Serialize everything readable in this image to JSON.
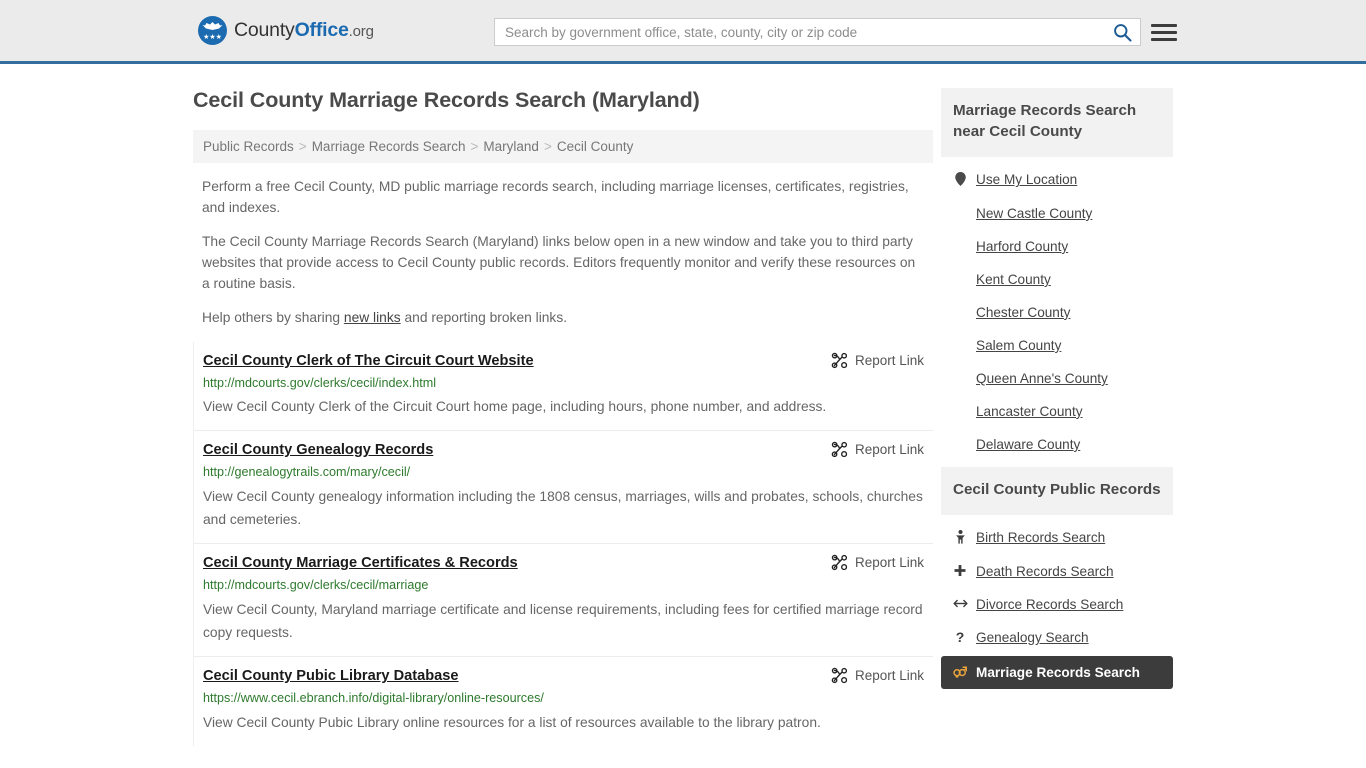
{
  "header": {
    "brand": {
      "part1": "County",
      "part2": "Office",
      "part3": ".org",
      "logo_icon": "eagle-shield-logo",
      "stars": "★★★"
    },
    "search": {
      "placeholder": "Search by government office, state, county, city or zip code",
      "value": "",
      "icon": "search-icon"
    },
    "menu_icon": "hamburger-menu-icon"
  },
  "page": {
    "title": "Cecil County Marriage Records Search (Maryland)",
    "breadcrumb": [
      {
        "label": "Public Records"
      },
      {
        "label": "Marriage Records Search"
      },
      {
        "label": "Maryland"
      },
      {
        "label": "Cecil County"
      }
    ],
    "breadcrumb_separator": ">",
    "intro": [
      "Perform a free Cecil County, MD public marriage records search, including marriage licenses, certificates, registries, and indexes.",
      "The Cecil County Marriage Records Search (Maryland) links below open in a new window and take you to third party websites that provide access to Cecil County public records. Editors frequently monitor and verify these resources on a routine basis."
    ],
    "help_prefix": "Help others by sharing ",
    "help_link": "new links",
    "help_suffix": " and reporting broken links."
  },
  "results": {
    "report_label": "Report Link",
    "report_icon": "broken-link-icon",
    "items": [
      {
        "title": "Cecil County Clerk of The Circuit Court Website",
        "url": "http://mdcourts.gov/clerks/cecil/index.html",
        "description": "View Cecil County Clerk of the Circuit Court home page, including hours, phone number, and address."
      },
      {
        "title": "Cecil County Genealogy Records",
        "url": "http://genealogytrails.com/mary/cecil/",
        "description": "View Cecil County genealogy information including the 1808 census, marriages, wills and probates, schools, churches and cemeteries."
      },
      {
        "title": "Cecil County Marriage Certificates & Records",
        "url": "http://mdcourts.gov/clerks/cecil/marriage",
        "description": "View Cecil County, Maryland marriage certificate and license requirements, including fees for certified marriage record copy requests."
      },
      {
        "title": "Cecil County Pubic Library Database",
        "url": "https://www.cecil.ebranch.info/digital-library/online-resources/",
        "description": "View Cecil County Pubic Library online resources for a list of resources available to the library patron."
      }
    ]
  },
  "sidebar": {
    "nearby": {
      "heading": "Marriage Records Search near Cecil County",
      "use_my_location": {
        "label": "Use My Location",
        "icon": "map-pin-icon"
      },
      "counties": [
        {
          "label": "New Castle County"
        },
        {
          "label": "Harford County"
        },
        {
          "label": "Kent County"
        },
        {
          "label": "Chester County"
        },
        {
          "label": "Salem County"
        },
        {
          "label": "Queen Anne's County"
        },
        {
          "label": "Lancaster County"
        },
        {
          "label": "Delaware County"
        }
      ]
    },
    "public_records": {
      "heading": "Cecil County Public Records",
      "items": [
        {
          "label": "Birth Records Search",
          "icon": "baby-icon",
          "glyph": "\u0001",
          "active": false
        },
        {
          "label": "Death Records Search",
          "icon": "cross-icon",
          "glyph": "✚",
          "active": false
        },
        {
          "label": "Divorce Records Search",
          "icon": "divorce-arrows-icon",
          "glyph": "↔",
          "active": false
        },
        {
          "label": "Genealogy Search",
          "icon": "question-mark-icon",
          "glyph": "?",
          "active": false
        },
        {
          "label": "Marriage Records Search",
          "icon": "male-female-icon",
          "glyph": "⚥",
          "active": true
        }
      ]
    }
  },
  "colors": {
    "accent_blue": "#1c6bb0",
    "header_border": "#336e9e",
    "header_bg": "#ebebeb",
    "url_green": "#2d7a2d",
    "active_bg": "#3c3c3c",
    "active_icon": "#e8a33d"
  }
}
